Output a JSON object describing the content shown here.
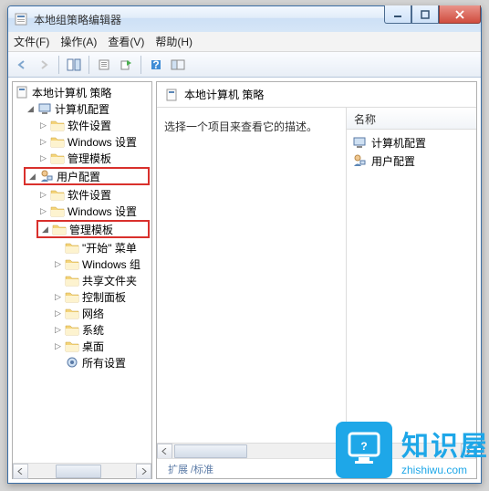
{
  "window": {
    "title": "本地组策略编辑器"
  },
  "menu": {
    "file": "文件(F)",
    "action": "操作(A)",
    "view": "查看(V)",
    "help": "帮助(H)"
  },
  "tree": {
    "root": "本地计算机 策略",
    "computer_config": "计算机配置",
    "software_settings": "软件设置",
    "windows_settings": "Windows 设置",
    "admin_templates": "管理模板",
    "user_config": "用户配置",
    "start_menu": "\"开始\" 菜单",
    "windows_comp": "Windows 组",
    "shared_folders": "共享文件夹",
    "control_panel": "控制面板",
    "network": "网络",
    "system": "系统",
    "desktop": "桌面",
    "all_settings": "所有设置"
  },
  "right": {
    "heading": "本地计算机 策略",
    "description": "选择一个项目来查看它的描述。",
    "col_name": "名称",
    "item_computer": "计算机配置",
    "item_user": "用户配置",
    "tab": "扩展 /标准"
  },
  "watermark": {
    "title": "知识屋",
    "sub": "zhishiwu.com"
  }
}
